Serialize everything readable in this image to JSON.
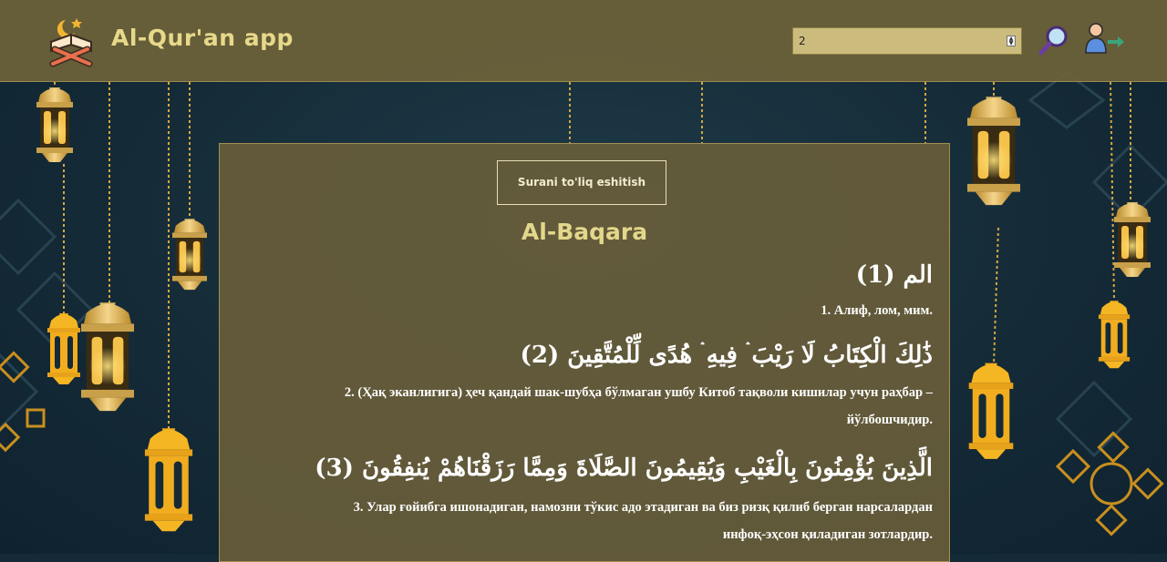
{
  "header": {
    "app_title": "Al-Qur'an app",
    "logo_icon": "quran-on-stand-icon",
    "search": {
      "value": "2"
    },
    "search_icon": "magnifier-icon",
    "user_icon": "user-arrow-icon"
  },
  "panel": {
    "listen_label": "Surani to'liq eshitish",
    "surah_name": "Al-Baqara",
    "verses": [
      {
        "arabic": "الم (1)",
        "translation": "1. Алиф, лом, мим."
      },
      {
        "arabic": "ذَٰلِكَ الْكِتَابُ لَا رَيْبَ ۛ فِيهِ ۛ هُدًى لِّلْمُتَّقِينَ (2)",
        "translation_line1": "2. (Ҳақ эканлигига) ҳеч қандай шак-шубҳа бўлмаган ушбу Китоб тақволи кишилар учун раҳбар –",
        "translation_line2": "йўлбошчидир."
      },
      {
        "arabic": "الَّذِينَ يُؤْمِنُونَ بِالْغَيْبِ وَيُقِيمُونَ الصَّلَاةَ وَمِمَّا رَزَقْنَاهُمْ يُنفِقُونَ (3)",
        "translation_line1": "3. Улар ғойибга ишонадиган, намозни тўкис адо этадиган ва биз ризқ қилиб берган нарсалардан",
        "translation_line2": "инфоқ-эҳсон қиладиган зотлардир."
      }
    ]
  },
  "colors": {
    "header_bg": "#6e623a",
    "panel_bg": "#695e3a",
    "title_gold": "#e3d78b",
    "background": "#142a36",
    "lantern_gold": "#f0b52a"
  }
}
